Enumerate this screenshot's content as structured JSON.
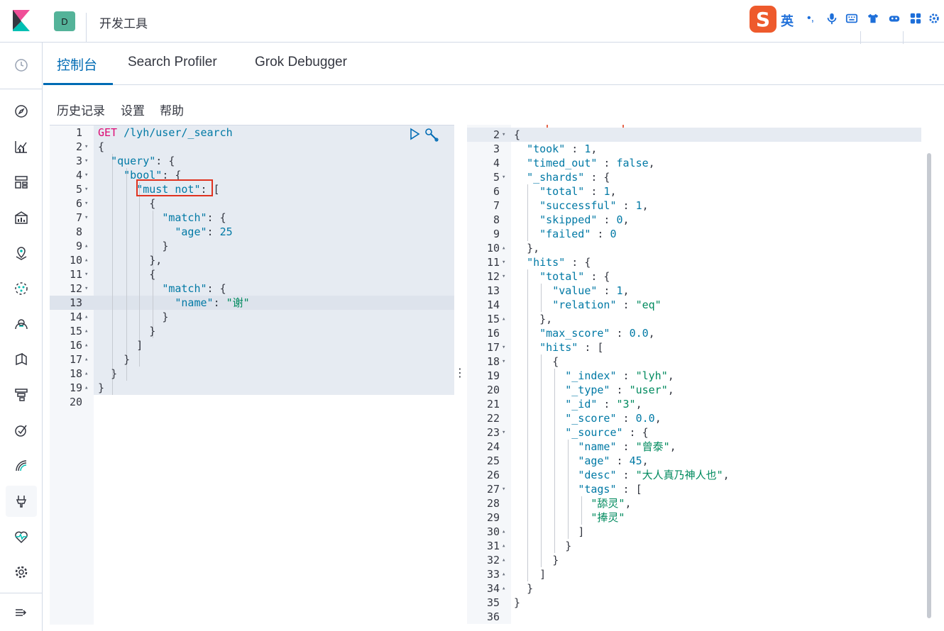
{
  "header": {
    "space_initial": "D",
    "app_title": "开发工具"
  },
  "ime": {
    "logo": "S",
    "lang": "英",
    "icons": [
      "punctuation-icon",
      "microphone-icon",
      "keyboard-icon",
      "skin-icon",
      "game-icon",
      "apps-icon",
      "settings-icon"
    ]
  },
  "sidenav": {
    "items": [
      "recent-icon",
      "discover-icon",
      "visualize-icon",
      "dashboard-icon",
      "canvas-icon",
      "maps-icon",
      "ml-icon",
      "metrics-icon",
      "logs-icon",
      "apm-icon",
      "uptime-icon",
      "siem-icon",
      "devtools-icon",
      "monitoring-icon",
      "management-icon",
      "collapse-icon"
    ]
  },
  "tabs": [
    {
      "label": "控制台",
      "active": true
    },
    {
      "label": "Search Profiler",
      "active": false
    },
    {
      "label": "Grok Debugger",
      "active": false
    }
  ],
  "submenu": [
    "历史记录",
    "设置",
    "帮助"
  ],
  "request": {
    "line1_method": "GET",
    "line1_path": "/lyh/user/_search",
    "line_numbers": [
      "1",
      "2",
      "3",
      "4",
      "5",
      "6",
      "7",
      "8",
      "9",
      "10",
      "11",
      "12",
      "13",
      "14",
      "15",
      "16",
      "17",
      "18",
      "19",
      "20"
    ]
  },
  "response": {
    "line_numbers": [
      "2",
      "3",
      "4",
      "5",
      "6",
      "7",
      "8",
      "9",
      "10",
      "11",
      "12",
      "13",
      "14",
      "15",
      "16",
      "17",
      "18",
      "19",
      "20",
      "21",
      "22",
      "23",
      "24",
      "25",
      "26",
      "27",
      "28",
      "29",
      "30",
      "31",
      "32",
      "33",
      "34",
      "35",
      "36"
    ]
  },
  "colors": {
    "accent": "#006bb4",
    "highlight_box": "#e0321f",
    "string": "#008a5e",
    "key": "#0079a5",
    "method": "#dd0a73"
  }
}
